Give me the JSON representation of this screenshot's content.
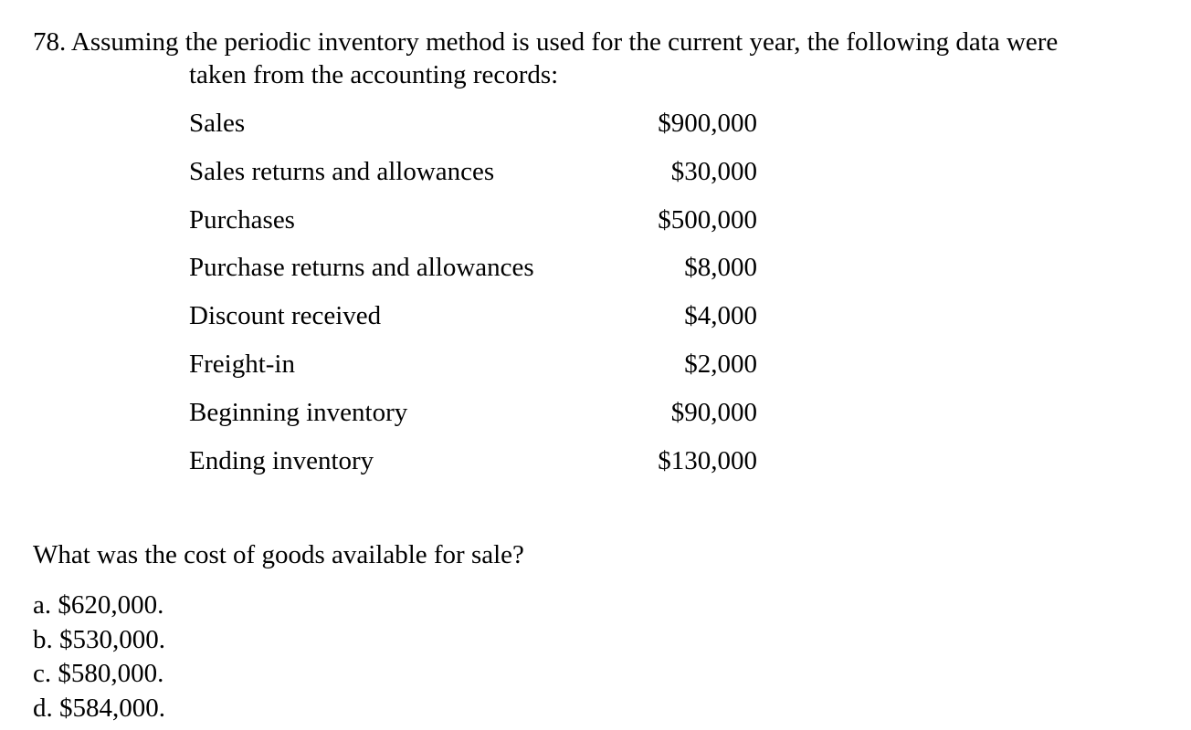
{
  "question": {
    "number": "78.",
    "stem_line1": "78. Assuming the periodic inventory method is used for the current year, the following data were",
    "stem_line2": "taken from the accounting records:",
    "data_rows": [
      {
        "label": "Sales",
        "value": "$900,000"
      },
      {
        "label": "Sales returns and allowances",
        "value": "$30,000"
      },
      {
        "label": "Purchases",
        "value": "$500,000"
      },
      {
        "label": "Purchase returns and allowances",
        "value": "$8,000"
      },
      {
        "label": "Discount received",
        "value": "$4,000"
      },
      {
        "label": "Freight-in",
        "value": "$2,000"
      },
      {
        "label": "Beginning inventory",
        "value": "$90,000"
      },
      {
        "label": "Ending inventory",
        "value": "$130,000"
      }
    ],
    "prompt": "What was the cost of goods available for sale?",
    "options": [
      {
        "letter": "a.",
        "text": "a. $620,000."
      },
      {
        "letter": "b.",
        "text": "b. $530,000."
      },
      {
        "letter": "c.",
        "text": "c. $580,000."
      },
      {
        "letter": "d.",
        "text": "d. $584,000."
      }
    ]
  }
}
